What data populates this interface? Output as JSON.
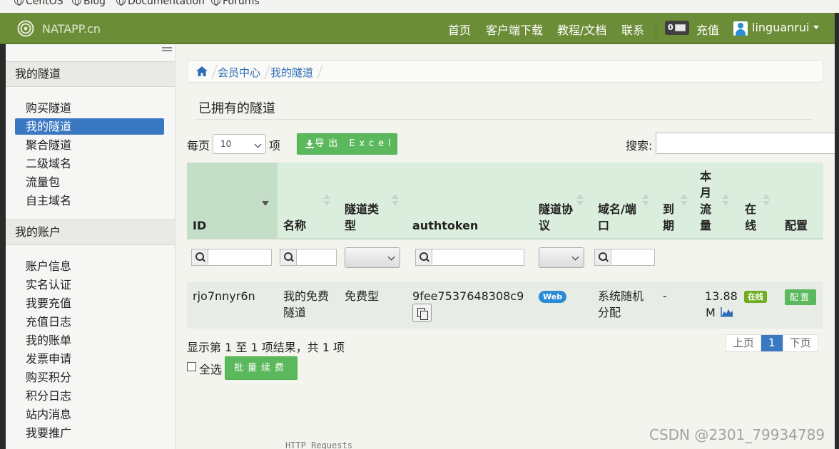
{
  "bookmarks": [
    "CentOS",
    "Blog",
    "Documentation",
    "Forums"
  ],
  "navbar": {
    "brand": "NATAPP.cn",
    "links": [
      "首页",
      "客户端下载",
      "教程/文档",
      "联系"
    ],
    "message_count": "0",
    "recharge": "充值",
    "username": "linguanrui"
  },
  "sidebar": {
    "section1_title": "我的隧道",
    "section1_items": [
      "购买隧道",
      "我的隧道",
      "聚合隧道",
      "二级域名",
      "流量包",
      "自主域名"
    ],
    "active_item": "我的隧道",
    "section2_title": "我的账户",
    "section2_items": [
      "账户信息",
      "实名认证",
      "我要充值",
      "充值日志",
      "我的账单",
      "发票申请",
      "购买积分",
      "积分日志",
      "站内消息",
      "我要推广"
    ]
  },
  "breadcrumb": [
    "会员中心",
    "我的隧道"
  ],
  "page_title": "已拥有的隧道",
  "controls": {
    "per_page_prefix": "每页",
    "per_page_value": "10",
    "per_page_suffix": "项",
    "export_label": "导出 Excel",
    "search_label": "搜索:"
  },
  "table": {
    "headers": {
      "id": "ID",
      "name": "名称",
      "type_l1": "隧道类",
      "type_l2": "型",
      "authtoken": "authtoken",
      "proto_l1": "隧道协",
      "proto_l2": "议",
      "domain_l1": "域名/端",
      "domain_l2": "口",
      "expire_l1": "到",
      "expire_l2": "期",
      "traffic_l1": "本",
      "traffic_l2": "月",
      "traffic_l3": "流",
      "traffic_l4": "量",
      "online_l1": "在",
      "online_l2": "线",
      "config": "配置"
    },
    "row": {
      "id": "rjo7nnyr6n",
      "name_l1": "我的免费",
      "name_l2": "隧道",
      "type": "免费型",
      "authtoken": "9fee7537648308c9",
      "protocol": "Web",
      "domain_l1": "系统随机",
      "domain_l2": "分配",
      "expire": "-",
      "traffic_l1": "13.88",
      "traffic_l2": "M",
      "online": "在线",
      "config": "配置"
    }
  },
  "footer": {
    "summary": "显示第 1 至 1 项结果，共 1 项",
    "select_all": "全选",
    "batch_renew": "批量续费",
    "prev": "上页",
    "current_page": "1",
    "next": "下页"
  },
  "under_text": "HTTP Requests",
  "watermark": "CSDN @2301_79934789",
  "colors": {
    "navbar": "#6c8d37",
    "active_sidebar": "#3a78c2",
    "green_button": "#5cb85c",
    "table_header": "#dbeedd",
    "web_label": "#2a8bd6",
    "online_label": "#6fae1f"
  }
}
